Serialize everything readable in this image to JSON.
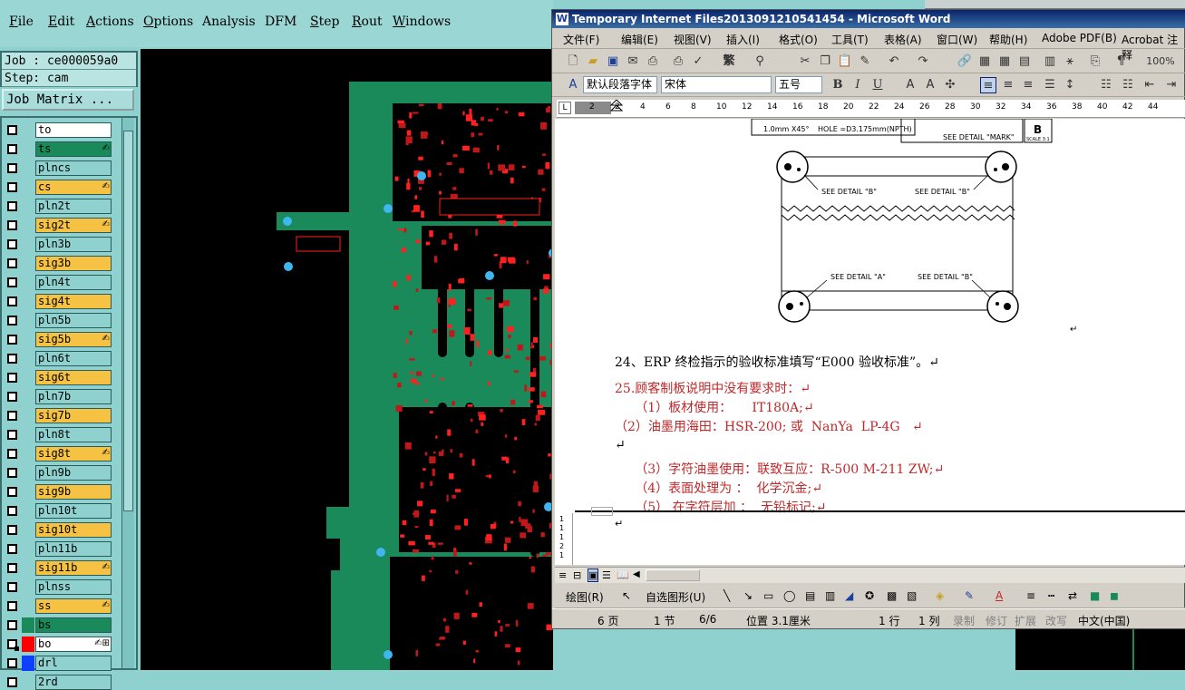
{
  "cam": {
    "menu": [
      {
        "label": "File",
        "key": "F"
      },
      {
        "label": "Edit",
        "key": "E"
      },
      {
        "label": "Actions",
        "key": "A"
      },
      {
        "label": "Options",
        "key": "O"
      },
      {
        "label": "Analysis",
        "key": ""
      },
      {
        "label": "DFM",
        "key": ""
      },
      {
        "label": "Step",
        "key": "S"
      },
      {
        "label": "Rout",
        "key": "R"
      },
      {
        "label": "Windows",
        "key": "W"
      }
    ],
    "job_label": "Job : ce000059a0",
    "step_label": "Step: cam",
    "job_matrix_label": "Job Matrix ...",
    "layers": [
      {
        "name": "to",
        "color": "#ffffff",
        "swatch": "",
        "selected": false
      },
      {
        "name": "ts",
        "color": "#1a8a5a",
        "swatch": "",
        "selected": false,
        "mark": "✍"
      },
      {
        "name": "plncs",
        "color": "#8ed1cf",
        "swatch": "",
        "selected": false
      },
      {
        "name": "cs",
        "color": "#f5c244",
        "swatch": "",
        "selected": false,
        "mark": "✍"
      },
      {
        "name": "pln2t",
        "color": "#8ed1cf",
        "swatch": "",
        "selected": false
      },
      {
        "name": "sig2t",
        "color": "#f5c244",
        "swatch": "",
        "selected": false,
        "mark": "✍"
      },
      {
        "name": "pln3b",
        "color": "#8ed1cf",
        "swatch": "",
        "selected": false
      },
      {
        "name": "sig3b",
        "color": "#f5c244",
        "swatch": "",
        "selected": false
      },
      {
        "name": "pln4t",
        "color": "#8ed1cf",
        "swatch": "",
        "selected": false
      },
      {
        "name": "sig4t",
        "color": "#f5c244",
        "swatch": "",
        "selected": false
      },
      {
        "name": "pln5b",
        "color": "#8ed1cf",
        "swatch": "",
        "selected": false
      },
      {
        "name": "sig5b",
        "color": "#f5c244",
        "swatch": "",
        "selected": false,
        "mark": "✍"
      },
      {
        "name": "pln6t",
        "color": "#8ed1cf",
        "swatch": "",
        "selected": false
      },
      {
        "name": "sig6t",
        "color": "#f5c244",
        "swatch": "",
        "selected": false
      },
      {
        "name": "pln7b",
        "color": "#8ed1cf",
        "swatch": "",
        "selected": false
      },
      {
        "name": "sig7b",
        "color": "#f5c244",
        "swatch": "",
        "selected": false
      },
      {
        "name": "pln8t",
        "color": "#8ed1cf",
        "swatch": "",
        "selected": false
      },
      {
        "name": "sig8t",
        "color": "#f5c244",
        "swatch": "",
        "selected": false,
        "mark": "✍"
      },
      {
        "name": "pln9b",
        "color": "#8ed1cf",
        "swatch": "",
        "selected": false
      },
      {
        "name": "sig9b",
        "color": "#f5c244",
        "swatch": "",
        "selected": false
      },
      {
        "name": "pln10t",
        "color": "#8ed1cf",
        "swatch": "",
        "selected": false
      },
      {
        "name": "sig10t",
        "color": "#f5c244",
        "swatch": "",
        "selected": false
      },
      {
        "name": "pln11b",
        "color": "#8ed1cf",
        "swatch": "",
        "selected": false
      },
      {
        "name": "sig11b",
        "color": "#f5c244",
        "swatch": "",
        "selected": false,
        "mark": "✍"
      },
      {
        "name": "plnss",
        "color": "#8ed1cf",
        "swatch": "",
        "selected": false
      },
      {
        "name": "ss",
        "color": "#f5c244",
        "swatch": "",
        "selected": false,
        "mark": "✍"
      },
      {
        "name": "bs",
        "color": "#1a8a5a",
        "swatch": "#1a8a5a",
        "selected": false
      },
      {
        "name": "bo",
        "color": "#ffffff",
        "swatch": "#ff0000",
        "selected": true,
        "mark": "✍⊞"
      },
      {
        "name": "drl",
        "color": "#8ed1cf",
        "swatch": "#1040ff",
        "selected": false
      },
      {
        "name": "2rd",
        "color": "#8ed1cf",
        "swatch": "",
        "selected": false
      }
    ]
  },
  "word": {
    "title": "Temporary Internet Files2013091210541454 - Microsoft Word",
    "menu": [
      "文件(F)",
      "编辑(E)",
      "视图(V)",
      "插入(I)",
      "格式(O)",
      "工具(T)",
      "表格(A)",
      "窗口(W)",
      "帮助(H)",
      "Adobe PDF(B)",
      "Acrobat 注释"
    ],
    "zoom": "100%",
    "style_combo": "默认段落字体",
    "font_combo": "宋体",
    "size_combo": "五号",
    "toolbar_trad": "繁",
    "ruler_numbers": [
      "2",
      "2",
      "4",
      "6",
      "8",
      "10",
      "12",
      "14",
      "16",
      "18",
      "20",
      "22",
      "24",
      "26",
      "28",
      "30",
      "32",
      "34",
      "36",
      "38",
      "40",
      "42",
      "44"
    ],
    "drawing": {
      "top_left_note": "1.0mm X45°",
      "hole_note": "HOLE =D3.175mm(NPTH)",
      "detail_mark": "SEE DETAIL \"MARK\"",
      "scale_letter": "B",
      "scale": "SCALE 3:1",
      "detail_b": "SEE DETAIL \"B\"",
      "detail_a": "SEE DETAIL \"A\""
    },
    "lines": [
      {
        "text": "24、ERP 终检指示的验收标准填写“E000 验收标准”。↵",
        "color": "#000000"
      },
      {
        "text": "25.顾客制板说明中没有要求时：↵",
        "color": "#c0282a"
      },
      {
        "text": "     （1）板材使用：     IT180A;↵",
        "color": "#c0282a"
      },
      {
        "text": "（2）油墨用海田：HSR-200; 或  NanYa  LP-4G   ↵",
        "color": "#c0282a"
      },
      {
        "text": "↵",
        "color": "#000000"
      },
      {
        "text": "     （3）字符油墨使用：联致互应：R-500 M-211 ZW;↵",
        "color": "#c0282a"
      },
      {
        "text": "     （4）表面处理为 ：  化学沉金;↵",
        "color": "#c0282a"
      },
      {
        "text": "     （5） 在字符层加 ：  无铅标记;↵",
        "color": "#c0282a"
      }
    ],
    "after_rule_mark": "↵",
    "paragraph_mark": "↵",
    "draw_label": "绘图(R)",
    "autoshape_label": "自选图形(U)",
    "status": {
      "page": "6 页",
      "section": "1 节",
      "pages": "6/6",
      "position": "位置 3.1厘米",
      "line": "1 行",
      "col": "1 列",
      "rec": "录制",
      "trk": "修订",
      "ext": "扩展",
      "ovr": "改写",
      "lang": "中文(中国)"
    }
  }
}
